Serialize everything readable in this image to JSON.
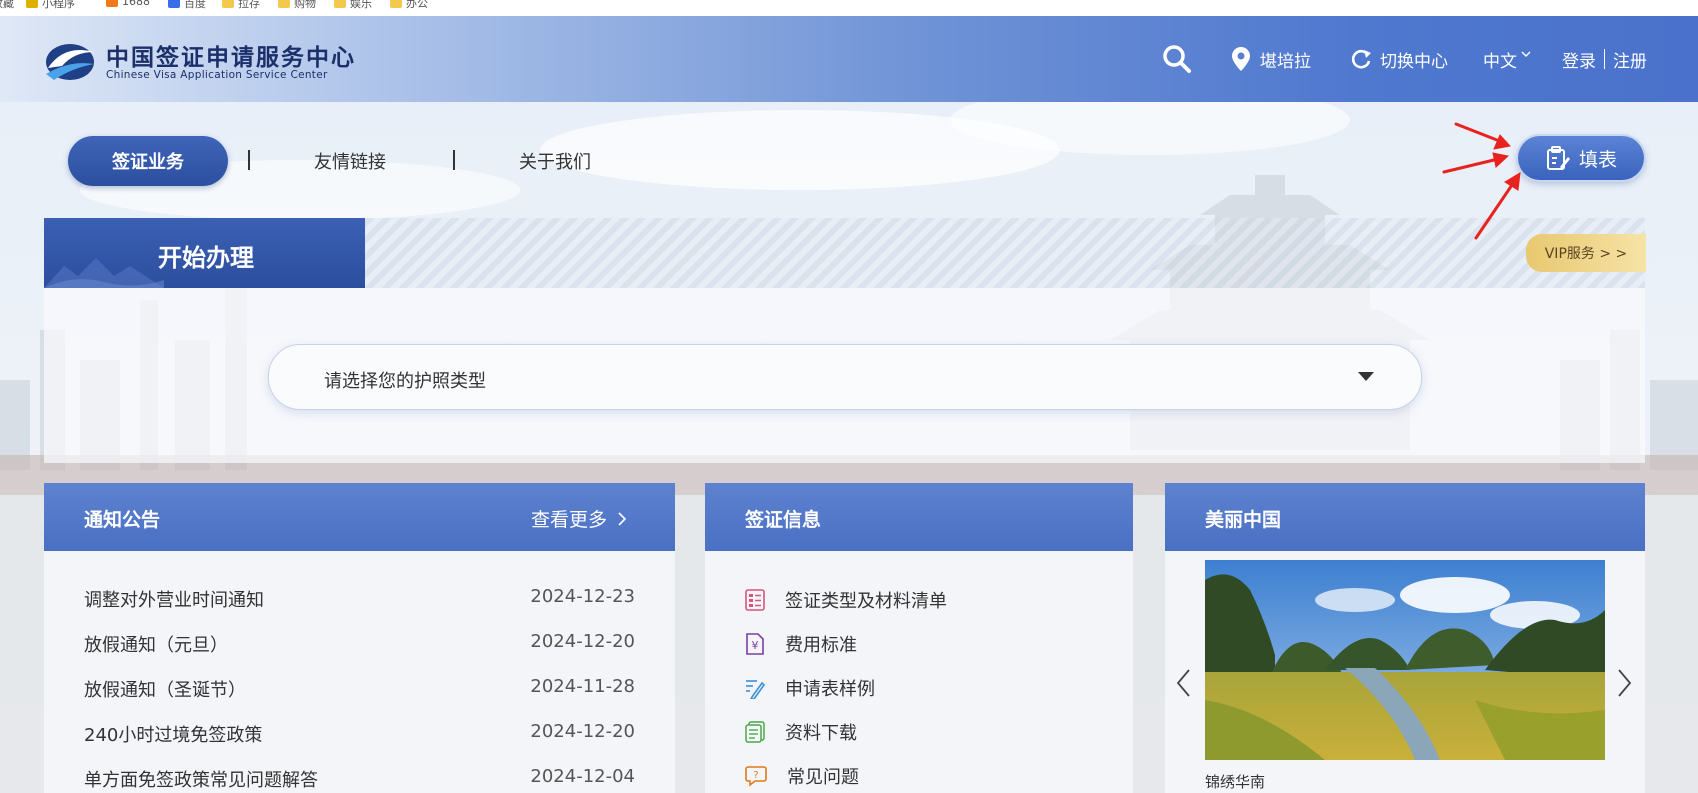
{
  "bookmarks": [
    {
      "label": "收藏",
      "color": "#888888"
    },
    {
      "label": "小程序",
      "color": "#e0b000"
    },
    {
      "label": "1688",
      "color": "#f07a1a"
    },
    {
      "label": "百度",
      "color": "#3a6ee8"
    },
    {
      "label": "拉存",
      "color": "#f2c94c"
    },
    {
      "label": "购物",
      "color": "#f2c94c"
    },
    {
      "label": "娱乐",
      "color": "#f2c94c"
    },
    {
      "label": "办公",
      "color": "#f2c94c"
    }
  ],
  "header": {
    "logo_cn": "中国签证申请服务中心",
    "logo_en": "Chinese Visa Application Service Center",
    "search_icon": "search-icon",
    "location": "堪培拉",
    "switch_center": "切换中心",
    "language": "中文",
    "login": "登录",
    "register": "注册"
  },
  "subnav": {
    "items": [
      "签证业务",
      "友情链接",
      "关于我们"
    ],
    "fill_form": "填表"
  },
  "start": {
    "title": "开始办理",
    "vip": "VIP服务 > >",
    "select_placeholder": "请选择您的护照类型"
  },
  "notices": {
    "title": "通知公告",
    "more": "查看更多",
    "items": [
      {
        "text": "调整对外营业时间通知",
        "date": "2024-12-23"
      },
      {
        "text": "放假通知（元旦）",
        "date": "2024-12-20"
      },
      {
        "text": "放假通知（圣诞节）",
        "date": "2024-11-28"
      },
      {
        "text": "240小时过境免签政策",
        "date": "2024-12-20"
      },
      {
        "text": "单方面免签政策常见问题解答",
        "date": "2024-12-04"
      }
    ]
  },
  "visa_info": {
    "title": "签证信息",
    "items": [
      {
        "label": "签证类型及材料清单",
        "icon": "checklist-icon",
        "color": "#d8557a"
      },
      {
        "label": "费用标准",
        "icon": "yuan-document-icon",
        "color": "#7b3fa0"
      },
      {
        "label": "申请表样例",
        "icon": "form-pen-icon",
        "color": "#3a8fd8"
      },
      {
        "label": "资料下载",
        "icon": "download-document-icon",
        "color": "#4aa84a"
      },
      {
        "label": "常见问题",
        "icon": "question-bubble-icon",
        "color": "#e07a1a"
      }
    ]
  },
  "beautiful_china": {
    "title": "美丽中国",
    "caption": "锦绣华南"
  },
  "colors": {
    "primary": "#2c4f9f",
    "header_blue": "#4a72cc",
    "card_head": "#5077c8",
    "vip_gold": "#eccf7c",
    "annotation_red": "#e8231f"
  }
}
